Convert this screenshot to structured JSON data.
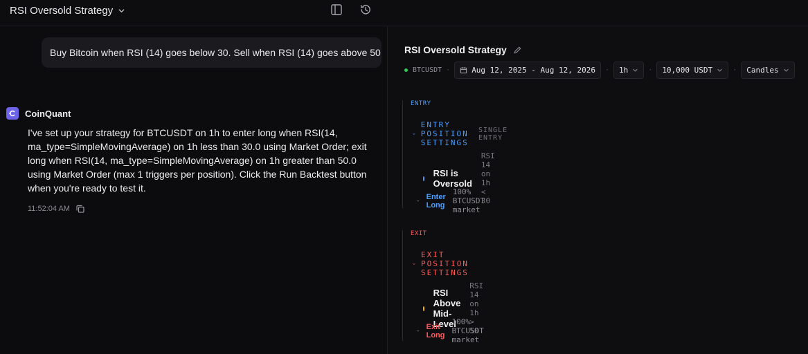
{
  "header": {
    "title": "RSI Oversold Strategy",
    "icons": [
      "chevron-down-icon",
      "sidebar-layout-icon",
      "history-icon"
    ]
  },
  "chat": {
    "user_message": "Buy Bitcoin when RSI (14) goes below 30. Sell when RSI (14) goes above 50",
    "bot_name": "CoinQuant",
    "bot_message": "I've set up your strategy for BTCUSDT on 1h to enter long when RSI(14, ma_type=SimpleMovingAverage) on 1h less than 30.0 using Market Order; exit long when RSI(14, ma_type=SimpleMovingAverage) on 1h greater than 50.0 using Market Order (max 1 triggers per position). Click the Run Backtest button when you're ready to test it.",
    "timestamp": "11:52:04 AM"
  },
  "strategy": {
    "title": "RSI Oversold Strategy",
    "symbol": "BTCUSDT",
    "date_range": "Aug 12, 2025 - Aug 12, 2026",
    "timeframe": "1h",
    "capital": "10,000 USDT",
    "chart_type": "Candles",
    "entry": {
      "tag": "ENTRY",
      "heading": "ENTRY POSITION SETTINGS",
      "subheading": "SINGLE ENTRY",
      "condition_name": "RSI is Oversold",
      "condition_expr": "RSI 14 on 1h < 30",
      "action": "Enter Long",
      "action_detail": "100% BTCUSDT market"
    },
    "exit": {
      "tag": "EXIT",
      "heading": "EXIT POSITION SETTINGS",
      "condition_name": "RSI Above Mid-Level",
      "condition_expr": "RSI 14 on 1h > 50",
      "action": "Exit Long",
      "action_detail": "100% BTCUSDT market"
    }
  },
  "colors": {
    "entry_accent": "#4a9eff",
    "exit_accent": "#ff5a5a",
    "entry_dot": "#5b9ef0",
    "exit_dot": "#f5c000",
    "status_dot": "#34c759",
    "avatar": "#6d63e6"
  }
}
